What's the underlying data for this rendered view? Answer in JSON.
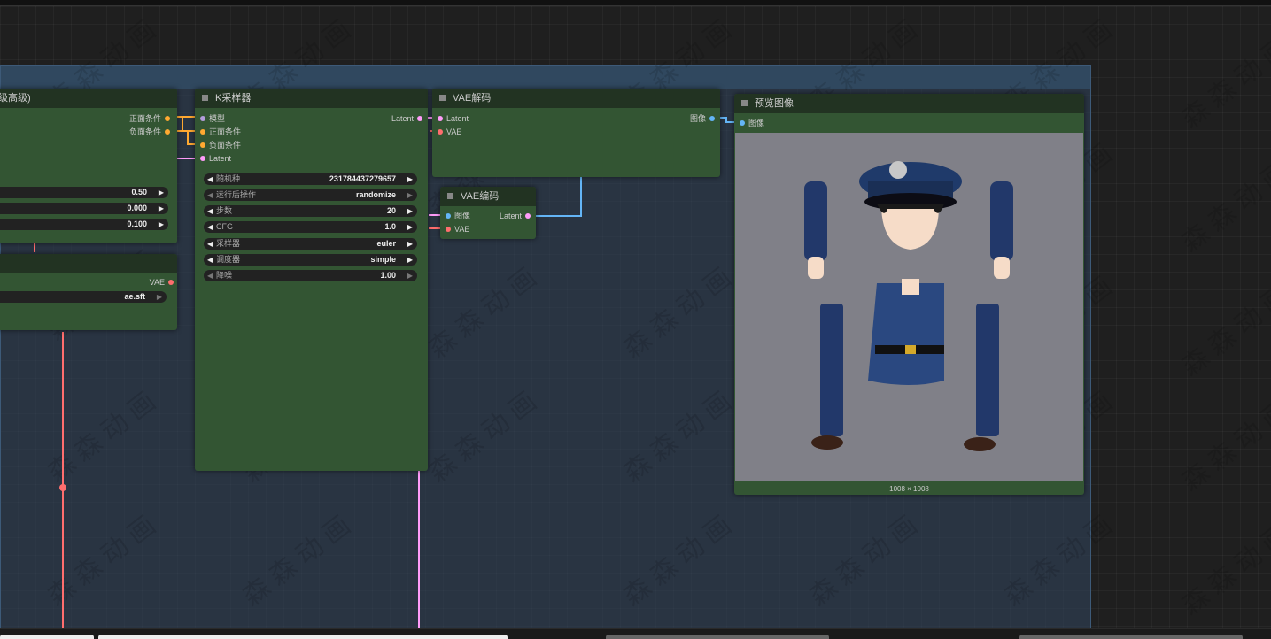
{
  "nodes": {
    "left_top": {
      "title": "级高级)",
      "outputs": [
        "正面条件",
        "负面条件"
      ],
      "widgets": [
        {
          "value": "0.50"
        },
        {
          "value": "0.000"
        },
        {
          "value": "0.100"
        }
      ]
    },
    "left_bottom": {
      "output": "VAE",
      "widget": {
        "value": "ae.sft"
      }
    },
    "ksampler": {
      "title": "K采样器",
      "inputs": [
        "模型",
        "正面条件",
        "负面条件",
        "Latent"
      ],
      "output": "Latent",
      "widgets": [
        {
          "label": "随机种",
          "value": "231784437279657"
        },
        {
          "label": "运行后操作",
          "value": "randomize"
        },
        {
          "label": "步数",
          "value": "20"
        },
        {
          "label": "CFG",
          "value": "1.0"
        },
        {
          "label": "采样器",
          "value": "euler"
        },
        {
          "label": "调度器",
          "value": "simple"
        },
        {
          "label": "降噪",
          "value": "1.00"
        }
      ]
    },
    "vae_decode": {
      "title": "VAE解码",
      "inputs": [
        "Latent",
        "VAE"
      ],
      "output": "图像"
    },
    "vae_encode": {
      "title": "VAE编码",
      "inputs": [
        "图像",
        "VAE"
      ],
      "output": "Latent"
    },
    "preview": {
      "title": "预览图像",
      "input": "图像",
      "footer": "1008 × 1008"
    }
  },
  "watermark_text": "森森动画",
  "colors": {
    "node_body": "#335533",
    "node_header": "#223322",
    "group": "#32465f",
    "wire_latent": "#ff9cf9",
    "wire_vae": "#ff6e6e",
    "wire_conditioning": "#ffa931",
    "wire_image": "#64b5f6"
  }
}
